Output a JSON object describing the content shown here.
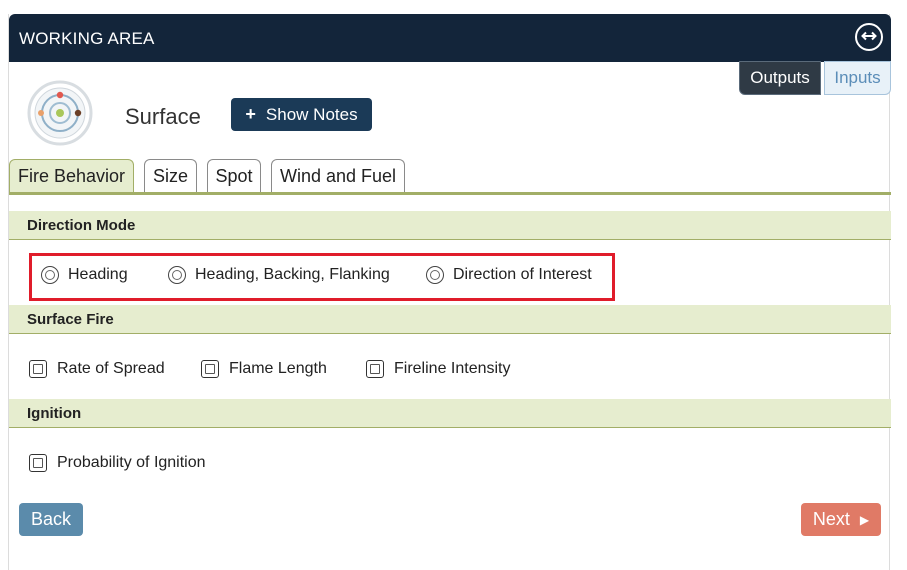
{
  "panel": {
    "title": "WORKING AREA",
    "expand_icon": "horizontal-arrows-icon"
  },
  "view_toggle": {
    "outputs_label": "Outputs",
    "inputs_label": "Inputs",
    "active": "Outputs"
  },
  "module": {
    "name": "Surface",
    "icon": "surface-module-icon",
    "show_notes_icon": "plus-icon",
    "show_notes_label": "Show Notes"
  },
  "tabs": [
    {
      "label": "Fire Behavior",
      "active": true
    },
    {
      "label": "Size",
      "active": false
    },
    {
      "label": "Spot",
      "active": false
    },
    {
      "label": "Wind and Fuel",
      "active": false
    }
  ],
  "sections": {
    "direction_mode": {
      "title": "Direction Mode",
      "options": [
        "Heading",
        "Heading, Backing, Flanking",
        "Direction of Interest"
      ]
    },
    "surface_fire": {
      "title": "Surface Fire",
      "options": [
        "Rate of Spread",
        "Flame Length",
        "Fireline Intensity"
      ]
    },
    "ignition": {
      "title": "Ignition",
      "options": [
        "Probability of Ignition"
      ]
    }
  },
  "nav": {
    "back_label": "Back",
    "next_label": "Next",
    "next_icon": "play-arrow-icon"
  },
  "colors": {
    "header_bg": "#13253a",
    "section_bg": "#e6edcf",
    "accent_rule": "#a2ae67",
    "highlight": "#e01c2a",
    "back_btn": "#5b8bab",
    "next_btn": "#e07a66"
  }
}
